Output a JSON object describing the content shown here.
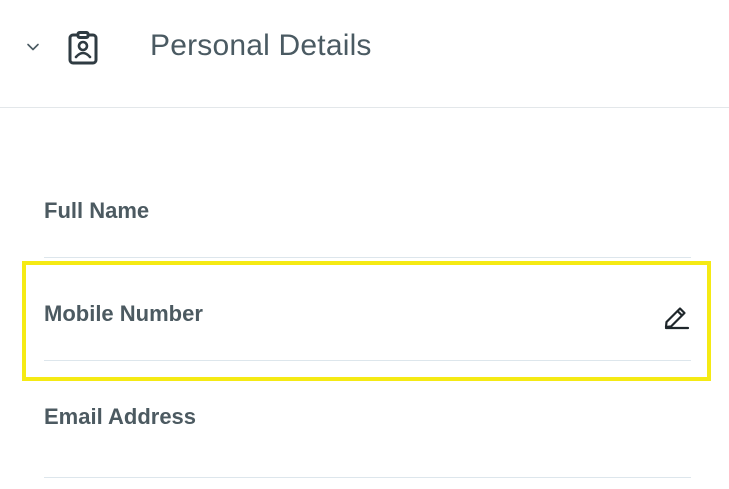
{
  "section": {
    "title": "Personal Details",
    "icons": {
      "toggle": "chevron-down-icon",
      "section": "id-badge-icon"
    }
  },
  "fields": {
    "full_name": {
      "label": "Full Name"
    },
    "mobile_number": {
      "label": "Mobile Number",
      "action_icon": "pencil-icon"
    },
    "email_address": {
      "label": "Email Address"
    }
  },
  "colors": {
    "highlight": "#f5ea14",
    "text": "#4c5a61",
    "divider": "#dde6ec"
  }
}
